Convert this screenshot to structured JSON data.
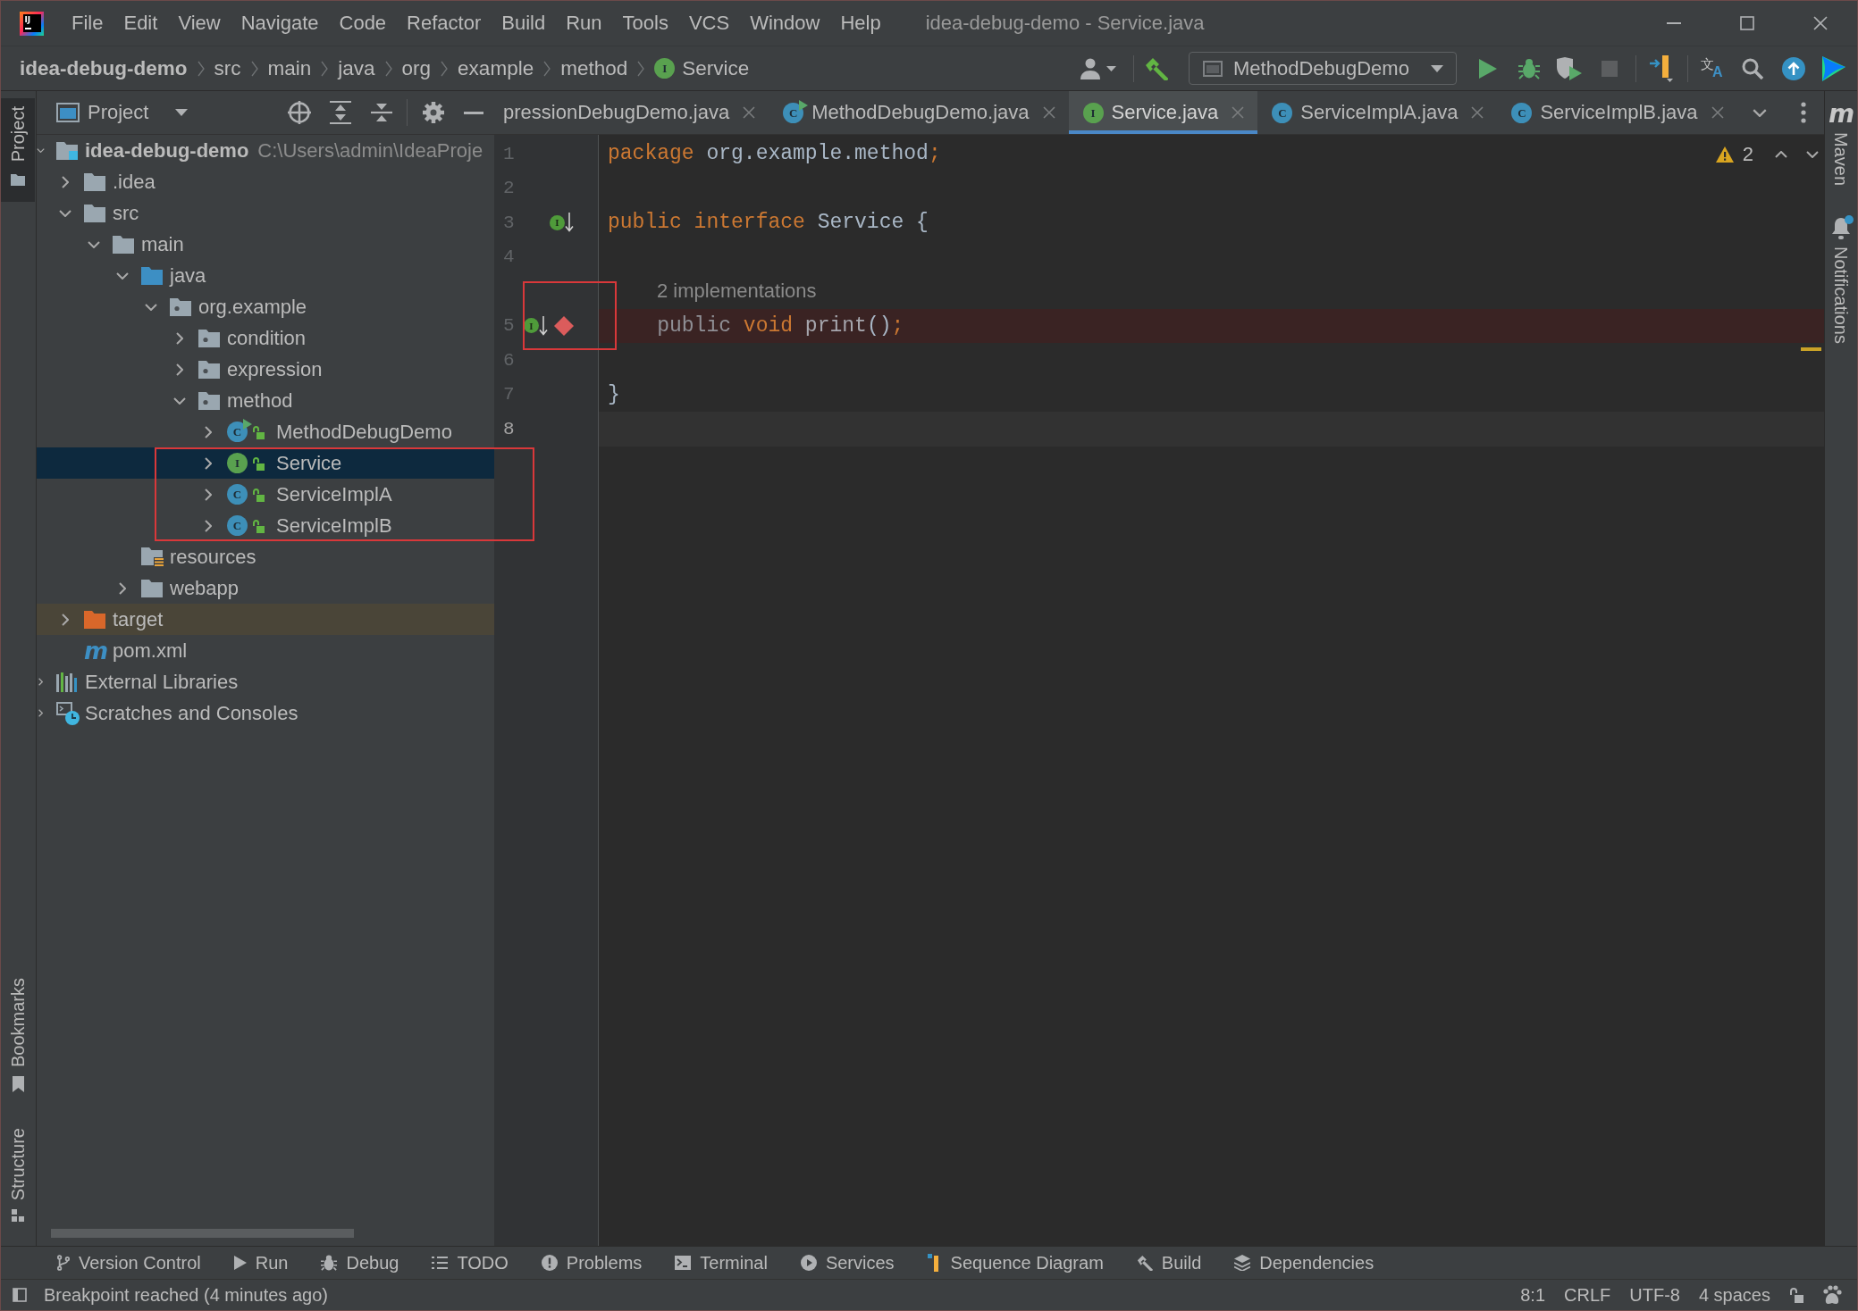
{
  "window": {
    "logo_text": "IJ",
    "title": "idea-debug-demo - Service.java"
  },
  "menu": [
    "File",
    "Edit",
    "View",
    "Navigate",
    "Code",
    "Refactor",
    "Build",
    "Run",
    "Tools",
    "VCS",
    "Window",
    "Help"
  ],
  "breadcrumbs": [
    {
      "label": "idea-debug-demo",
      "kind": "project"
    },
    {
      "label": "src",
      "kind": "folder"
    },
    {
      "label": "main",
      "kind": "folder"
    },
    {
      "label": "java",
      "kind": "folder"
    },
    {
      "label": "org",
      "kind": "folder"
    },
    {
      "label": "example",
      "kind": "folder"
    },
    {
      "label": "method",
      "kind": "folder"
    },
    {
      "label": "Service",
      "kind": "interface",
      "badge": "I"
    }
  ],
  "toolbar": {
    "run_configuration": "MethodDebugDemo",
    "stop_disabled": true,
    "translate_glyphs": [
      "文",
      "A"
    ]
  },
  "left_stripe": {
    "top": [
      {
        "label": "Project",
        "kind": "project",
        "selected": true
      }
    ],
    "bottom": [
      {
        "label": "Bookmarks",
        "kind": "bookmarks",
        "selected": false
      },
      {
        "label": "Structure",
        "kind": "structure",
        "selected": false
      }
    ]
  },
  "project_panel": {
    "title": "Project",
    "tree": [
      {
        "label": "idea-debug-demo",
        "kind": "module",
        "path": "C:\\Users\\admin\\IdeaProje",
        "expanded": true,
        "selected": false,
        "children": [
          {
            "label": ".idea",
            "kind": "folder",
            "expanded": false,
            "selected": false
          },
          {
            "label": "src",
            "kind": "folder",
            "expanded": true,
            "selected": false,
            "children": [
              {
                "label": "main",
                "kind": "folder",
                "expanded": true,
                "selected": false,
                "children": [
                  {
                    "label": "java",
                    "kind": "source-folder",
                    "expanded": true,
                    "selected": false,
                    "children": [
                      {
                        "label": "org.example",
                        "kind": "package",
                        "expanded": true,
                        "selected": false,
                        "children": [
                          {
                            "label": "condition",
                            "kind": "package",
                            "expanded": false,
                            "selected": false
                          },
                          {
                            "label": "expression",
                            "kind": "package",
                            "expanded": false,
                            "selected": false
                          },
                          {
                            "label": "method",
                            "kind": "package",
                            "expanded": true,
                            "selected": false,
                            "children": [
                              {
                                "label": "MethodDebugDemo",
                                "kind": "class-runnable",
                                "badge": "C",
                                "public": true,
                                "expanded": false,
                                "selected": false,
                                "framed": false
                              },
                              {
                                "label": "Service",
                                "kind": "interface",
                                "badge": "I",
                                "public": true,
                                "expanded": false,
                                "selected": true,
                                "framed": true
                              },
                              {
                                "label": "ServiceImplA",
                                "kind": "class",
                                "badge": "C",
                                "public": true,
                                "expanded": false,
                                "selected": false,
                                "framed": true
                              },
                              {
                                "label": "ServiceImplB",
                                "kind": "class",
                                "badge": "C",
                                "public": true,
                                "expanded": false,
                                "selected": false,
                                "framed": true
                              }
                            ]
                          }
                        ]
                      }
                    ]
                  },
                  {
                    "label": "resources",
                    "kind": "resources-folder",
                    "selected": false
                  },
                  {
                    "label": "webapp",
                    "kind": "folder",
                    "expanded": false,
                    "selected": false
                  }
                ]
              }
            ]
          },
          {
            "label": "target",
            "kind": "excluded-folder",
            "expanded": false,
            "selected": false
          },
          {
            "label": "pom.xml",
            "kind": "maven-pom",
            "badge": "m",
            "selected": false
          }
        ]
      },
      {
        "label": "External Libraries",
        "kind": "libraries",
        "expanded": false,
        "selected": false
      },
      {
        "label": "Scratches and Consoles",
        "kind": "scratches",
        "expanded": false,
        "selected": false
      }
    ]
  },
  "editor": {
    "tabs": [
      {
        "label": "pressionDebugDemo.java",
        "selected": false
      },
      {
        "label": "MethodDebugDemo.java",
        "kind": "class-runnable",
        "badge": "C",
        "selected": false
      },
      {
        "label": "Service.java",
        "kind": "interface",
        "badge": "I",
        "selected": true
      },
      {
        "label": "ServiceImplA.java",
        "kind": "class",
        "badge": "C",
        "selected": false
      },
      {
        "label": "ServiceImplB.java",
        "kind": "class",
        "badge": "C",
        "selected": false
      }
    ],
    "inspection": {
      "warnings": "2"
    },
    "lines": [
      {
        "number": "1",
        "tokens": [
          {
            "kind": "keyword",
            "text": "package"
          },
          {
            "kind": "plain",
            "text": " org.example.method"
          },
          {
            "kind": "keyword",
            "text": ";"
          }
        ],
        "breakpoint": false,
        "caret": false,
        "framed": false
      },
      {
        "number": "2",
        "breakpoint": false,
        "caret": false,
        "framed": false
      },
      {
        "number": "3",
        "gutter_badge": "I",
        "tokens": [
          {
            "kind": "keyword",
            "text": "public interface"
          },
          {
            "kind": "plain",
            "text": " Service {"
          }
        ],
        "breakpoint": false,
        "caret": false,
        "framed": false
      },
      {
        "number": "4",
        "breakpoint": false,
        "caret": false,
        "framed": false
      },
      {
        "number": "5",
        "hint": "2 implementations",
        "gutter_badge": "I",
        "tokens": [
          {
            "kind": "redundant",
            "text": "    public"
          },
          {
            "kind": "keyword",
            "text": " void"
          },
          {
            "kind": "method",
            "text": " print"
          },
          {
            "kind": "plain",
            "text": "()"
          },
          {
            "kind": "keyword",
            "text": ";"
          }
        ],
        "breakpoint": true,
        "caret": false,
        "framed": true
      },
      {
        "number": "6",
        "breakpoint": false,
        "caret": false,
        "framed": false
      },
      {
        "number": "7",
        "tokens": [
          {
            "kind": "plain",
            "text": "}"
          }
        ],
        "breakpoint": false,
        "caret": false,
        "framed": false
      },
      {
        "number": "8",
        "breakpoint": false,
        "caret": true,
        "framed": false
      }
    ]
  },
  "right_stripe": [
    {
      "label": "Maven",
      "kind": "maven",
      "badge": "m"
    },
    {
      "label": "Notifications",
      "kind": "notifications",
      "unread": true
    }
  ],
  "tool_windows": [
    {
      "label": "Version Control",
      "kind": "vcs"
    },
    {
      "label": "Run",
      "kind": "run"
    },
    {
      "label": "Debug",
      "kind": "debug"
    },
    {
      "label": "TODO",
      "kind": "todo"
    },
    {
      "label": "Problems",
      "kind": "problems"
    },
    {
      "label": "Terminal",
      "kind": "terminal"
    },
    {
      "label": "Services",
      "kind": "services"
    },
    {
      "label": "Sequence Diagram",
      "kind": "sequence"
    },
    {
      "label": "Build",
      "kind": "build"
    },
    {
      "label": "Dependencies",
      "kind": "dependencies"
    }
  ],
  "status_bar": {
    "message": "Breakpoint reached (4 minutes ago)",
    "widgets": [
      "8:1",
      "CRLF",
      "UTF-8",
      "4 spaces"
    ]
  }
}
